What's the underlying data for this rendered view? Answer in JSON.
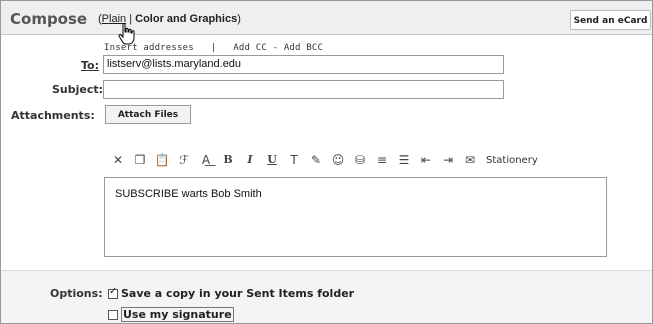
{
  "header": {
    "title": "Compose",
    "mode_open": "(",
    "mode_plain": "Plain",
    "mode_sep": " | ",
    "mode_color": "Color and Graphics",
    "mode_close": ")",
    "ecard_label": "Send an eCard"
  },
  "address": {
    "insert_addresses": "Insert addresses",
    "sep": "|",
    "add_cc_bcc": "Add CC - Add BCC",
    "to_label": "To:",
    "to_value": "listserv@lists.maryland.edu",
    "subject_label": "Subject:",
    "subject_value": "",
    "attachments_label": "Attachments:",
    "attach_button": "Attach Files"
  },
  "toolbar": {
    "stationery_label": "Stationery"
  },
  "body": {
    "text": "SUBSCRIBE warts Bob Smith"
  },
  "options": {
    "label": "Options:",
    "save_copy_label": "Save a copy in your Sent Items folder",
    "save_copy_checked": true,
    "use_signature_label": "Use my signature",
    "use_signature_checked": false
  }
}
